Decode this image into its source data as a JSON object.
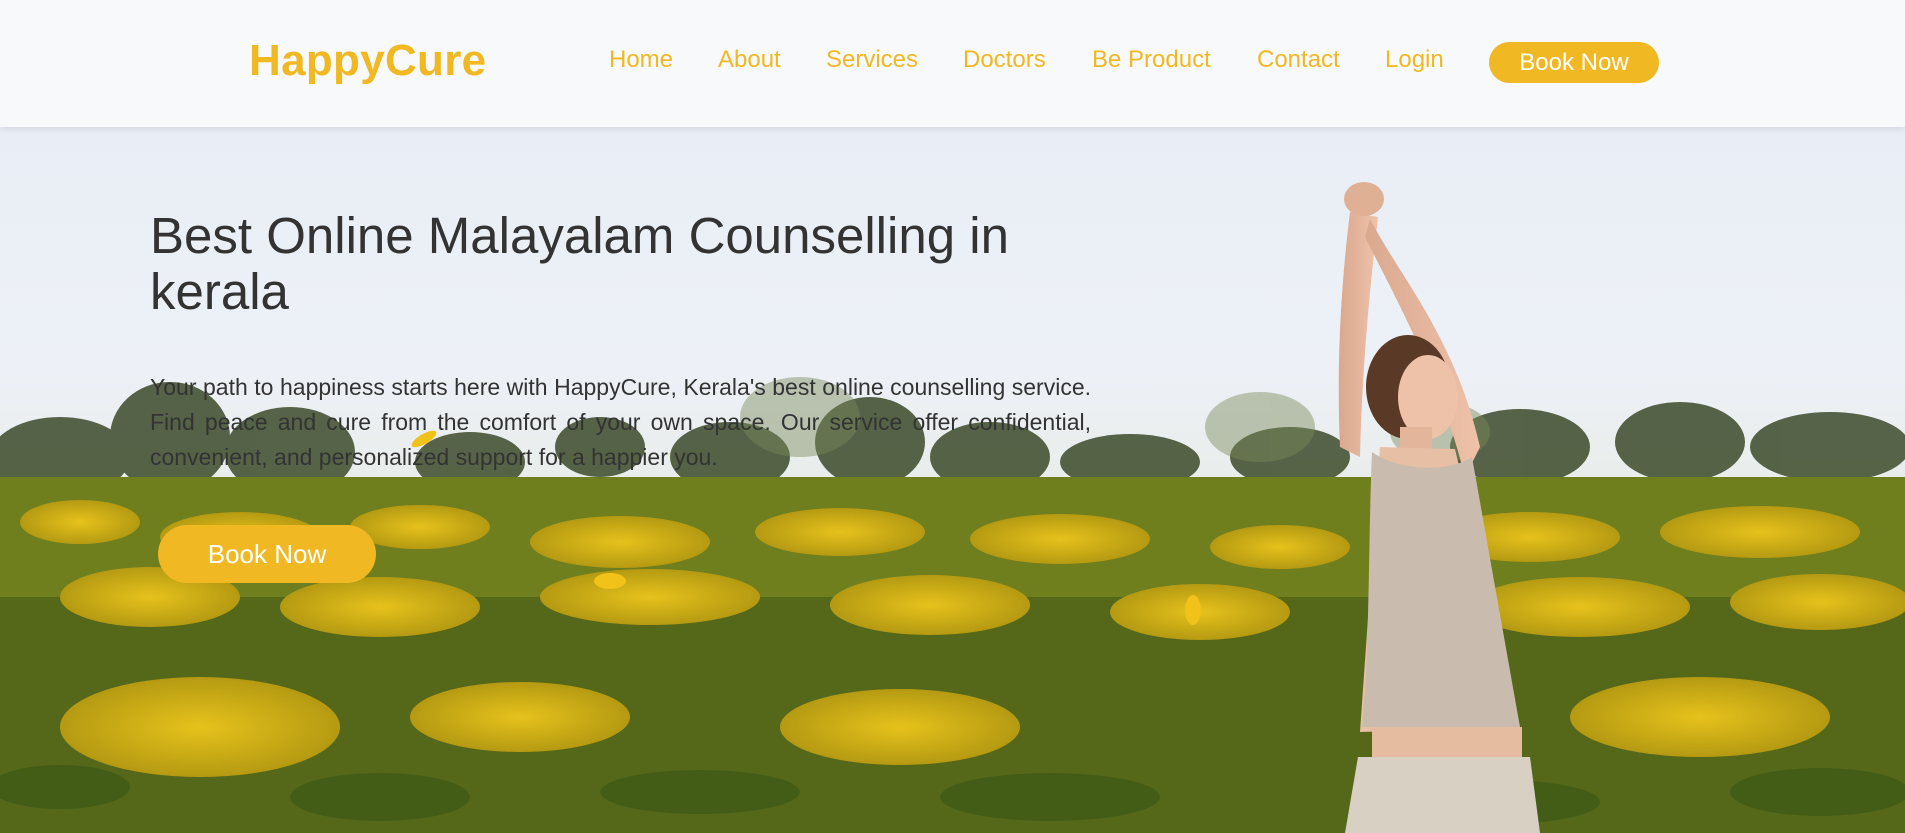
{
  "header": {
    "logo": "HappyCure",
    "nav": [
      "Home",
      "About",
      "Services",
      "Doctors",
      "Be Product",
      "Contact",
      "Login"
    ],
    "book_now": "Book Now"
  },
  "hero": {
    "title": "Best Online Malayalam Counselling in kerala",
    "description": "Your path to happiness starts here with HappyCure, Kerala's best online counselling service. Find peace and cure from the comfort of your own space. Our service offer confidential, convenient, and personalized support for a happier you.",
    "book_now": "Book Now",
    "background": "woman stretching arms up in a yellow flower field"
  },
  "colors": {
    "brand": "#f0b823",
    "text": "#333333",
    "header_bg": "#f8f9fa"
  }
}
